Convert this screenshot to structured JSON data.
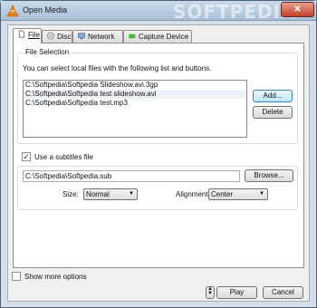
{
  "window": {
    "title": "Open Media",
    "watermark": "SOFTPEDIA",
    "close_glyph": "✕"
  },
  "tabs": [
    {
      "label": "File",
      "icon": "file-icon",
      "active": true
    },
    {
      "label": "Disc",
      "icon": "disc-icon",
      "active": false
    },
    {
      "label": "Network",
      "icon": "network-icon",
      "active": false
    },
    {
      "label": "Capture Device",
      "icon": "capture-device-icon",
      "active": false
    }
  ],
  "file_selection": {
    "group_label": "File Selection",
    "description": "You can select local files with the following list and buttons.",
    "files": [
      "C:\\Softpedia\\Softpedia Slideshow.avi.3gp",
      "C:\\Softpedia\\Softpedia test slideshow.avi",
      "C:\\Softpedia\\Softpedia test.mp3"
    ],
    "add_label": "Add...",
    "delete_label": "Delete"
  },
  "subtitles": {
    "checkbox_label": "Use a subtitles file",
    "checked": true,
    "file_value": "C:\\Softpedia\\Softpedia.sub",
    "browse_label": "Browse...",
    "size_label": "Size:",
    "size_value": "Normal",
    "alignment_label": "Alignment:",
    "alignment_value": "Center"
  },
  "footer": {
    "show_more_label": "Show more options",
    "show_more_checked": false,
    "play_label": "Play",
    "cancel_label": "Cancel"
  },
  "colors": {
    "accent": "#3c7fb1",
    "close": "#c0402a"
  }
}
